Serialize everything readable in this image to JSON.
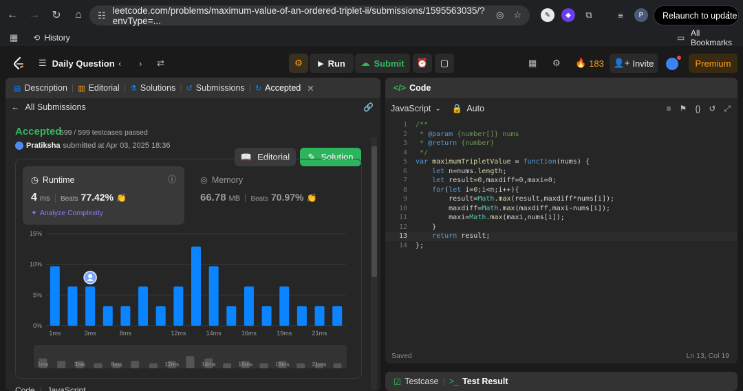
{
  "browser": {
    "url": "leetcode.com/problems/maximum-value-of-an-ordered-triplet-ii/submissions/1595563035/?envType=...",
    "relaunch_label": "Relaunch to update",
    "profile_initial": "P",
    "bookmarks": {
      "history_label": "History",
      "all_bookmarks_label": "All Bookmarks"
    }
  },
  "header": {
    "daily_question": "Daily Question",
    "run_label": "Run",
    "submit_label": "Submit",
    "streak_count": "183",
    "invite_label": "Invite",
    "premium_label": "Premium"
  },
  "left_tabs": [
    {
      "label": "Description",
      "icon": "description-icon"
    },
    {
      "label": "Editorial",
      "icon": "book-icon"
    },
    {
      "label": "Solutions",
      "icon": "flask-icon"
    },
    {
      "label": "Submissions",
      "icon": "history-icon"
    },
    {
      "label": "Accepted",
      "icon": "accepted-icon"
    }
  ],
  "submission": {
    "back_label": "All Submissions",
    "status": "Accepted",
    "testcases": "599 / 599 testcases passed",
    "user": "Pratiksha",
    "submitted_text": "submitted at Apr 03, 2025 18:36",
    "editorial_label": "Editorial",
    "solution_label": "Solution",
    "runtime": {
      "title": "Runtime",
      "value": "4",
      "unit": "ms",
      "beats_label": "Beats",
      "beats_value": "77.42%",
      "analyze_label": "Analyze Complexity"
    },
    "memory": {
      "title": "Memory",
      "value": "66.78",
      "unit": "MB",
      "beats_label": "Beats",
      "beats_value": "70.97%"
    },
    "code_label": "Code",
    "lang_label": "JavaScript"
  },
  "chart_data": {
    "type": "bar",
    "ylabel": "",
    "xlabel": "",
    "ylim": [
      0,
      15
    ],
    "ytick_labels": [
      "0%",
      "5%",
      "10%",
      "15%"
    ],
    "ytick_values": [
      0,
      5,
      10,
      15
    ],
    "x": [
      "1ms",
      "2ms",
      "3ms",
      "4ms",
      "8ms",
      "9ms",
      "11ms",
      "12ms",
      "13ms",
      "14ms",
      "15ms",
      "16ms",
      "17ms",
      "19ms",
      "20ms",
      "21ms",
      "22ms"
    ],
    "values": [
      9.7,
      6.4,
      6.4,
      3.2,
      3.2,
      6.4,
      3.2,
      6.4,
      12.9,
      9.7,
      3.2,
      6.4,
      3.2,
      6.4,
      3.2,
      3.2,
      3.2
    ],
    "xtick_labels": [
      "1ms",
      "3ms",
      "8ms",
      "12ms",
      "14ms",
      "16ms",
      "19ms",
      "21ms"
    ],
    "highlight_index": 2,
    "bar_color": "#0a84ff",
    "grid": true
  },
  "code": {
    "language": "JavaScript",
    "mode": "Auto",
    "panel_title": "Code",
    "lines": [
      "/**",
      " * @param {number[]} nums",
      " * @return {number}",
      " */",
      "var maximumTripletValue = function(nums) {",
      "    let n=nums.length;",
      "    let result=0,maxdiff=0,maxi=0;",
      "    for(let i=0;i<n;i++){",
      "        result=Math.max(result,maxdiff*nums[i]);",
      "        maxdiff=Math.max(maxdiff,maxi-nums[i]);",
      "        maxi=Math.max(maxi,nums[i]);",
      "    }",
      "    return result;",
      "};"
    ],
    "status_left": "Saved",
    "status_right": "Ln 13, Col 19"
  },
  "bottom_tabs": {
    "testcase": "Testcase",
    "test_result": "Test Result"
  },
  "colors": {
    "accent_green": "#2cbb5d",
    "premium": "#ffa116",
    "bar_blue": "#0a84ff"
  }
}
